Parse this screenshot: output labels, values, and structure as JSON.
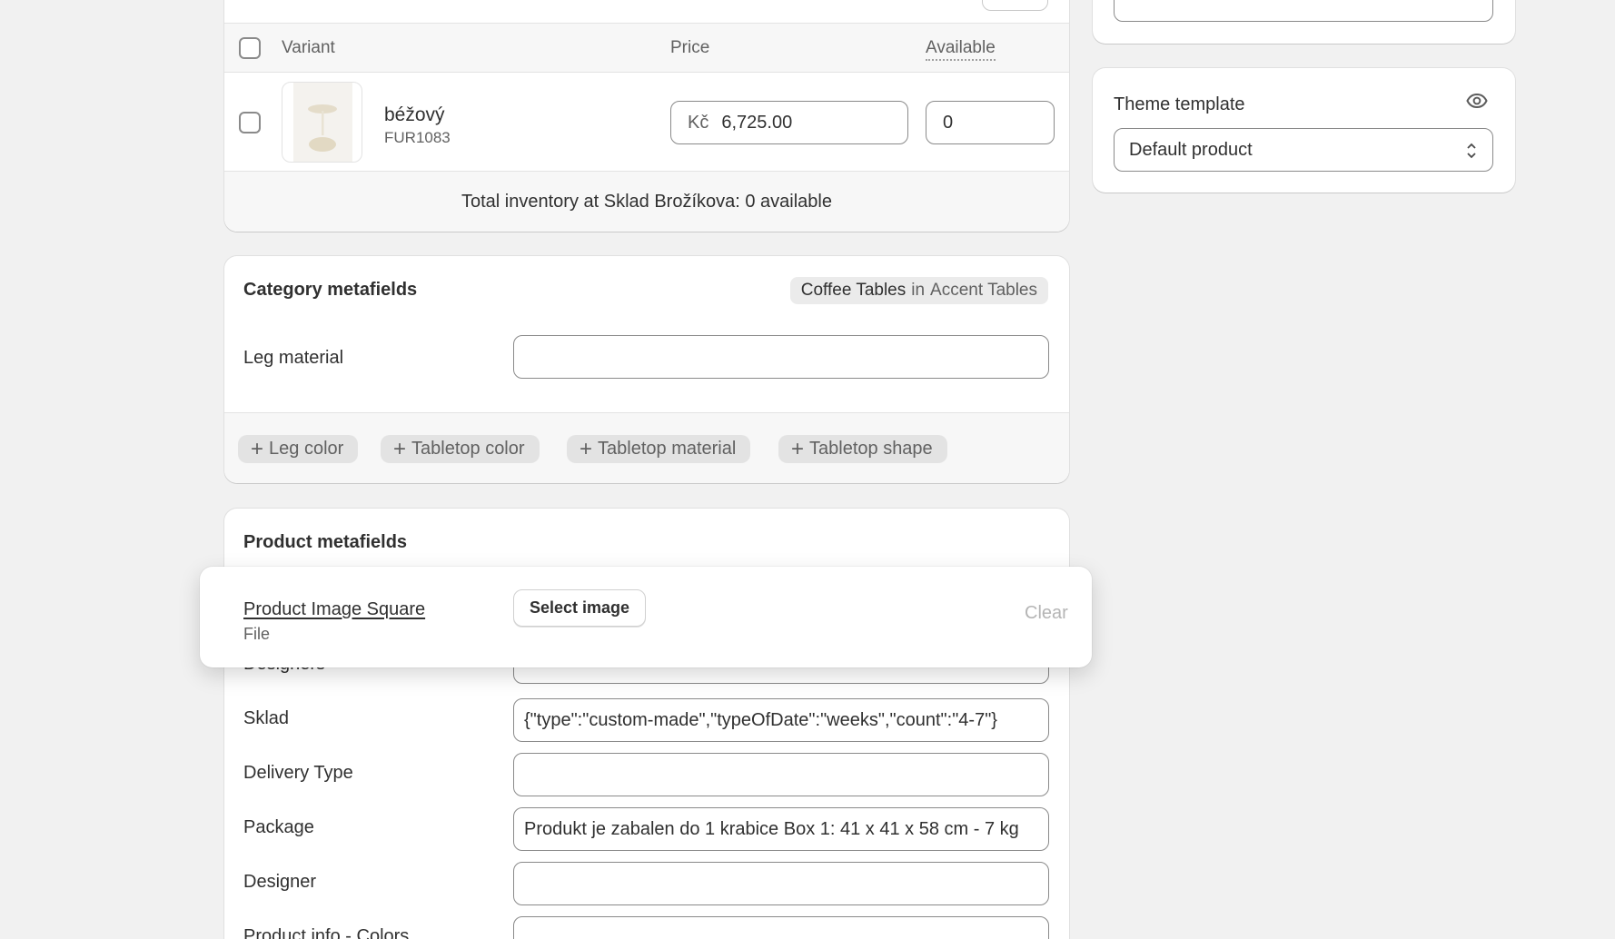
{
  "variants_card": {
    "headers": {
      "variant": "Variant",
      "price": "Price",
      "available": "Available"
    },
    "row": {
      "name": "béžový",
      "sku": "FUR1083",
      "currency": "Kč",
      "price": "6,725.00",
      "available": "0"
    },
    "total_inventory": "Total inventory at Sklad Brožíkova: 0 available"
  },
  "category_metafields": {
    "title": "Category metafields",
    "category_name": "Coffee Tables",
    "category_in": "in",
    "category_parent": "Accent Tables",
    "leg_material_label": "Leg material",
    "leg_material_value": "",
    "add_chips": [
      {
        "label": "Leg color"
      },
      {
        "label": "Tabletop color"
      },
      {
        "label": "Tabletop material"
      },
      {
        "label": "Tabletop shape"
      }
    ]
  },
  "product_metafields": {
    "title": "Product metafields",
    "designers_label": "Designers",
    "fields": [
      {
        "label": "Sklad",
        "value": "{\"type\":\"custom-made\",\"typeOfDate\":\"weeks\",\"count\":\"4-7\"}"
      },
      {
        "label": "Delivery Type",
        "value": ""
      },
      {
        "label": "Package",
        "value": "Produkt je zabalen do 1 krabice Box 1: 41 x 41 x 58 cm - 7 kg"
      },
      {
        "label": "Designer",
        "value": ""
      },
      {
        "label": "Product info - Colors",
        "value": ""
      }
    ]
  },
  "overlay": {
    "field_name": "Product Image Square",
    "field_type": "File",
    "select_label": "Select image",
    "clear_label": "Clear"
  },
  "theme_template": {
    "title": "Theme template",
    "selected": "Default product"
  }
}
